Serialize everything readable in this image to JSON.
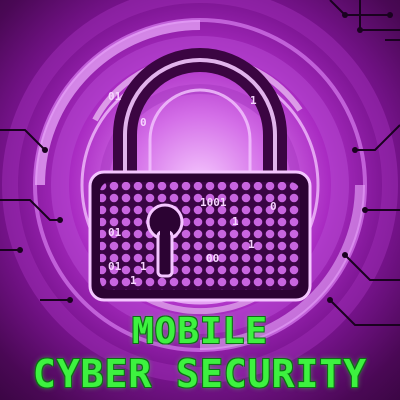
{
  "headline": {
    "line1": "MOBILE",
    "line2": "CYBER SECURITY"
  },
  "lock_digits": [
    "01",
    "1",
    "0",
    "1001",
    "1",
    "01",
    "1",
    "0",
    "00",
    "01",
    "1",
    "1"
  ],
  "colors": {
    "background": "#5a0c63",
    "glow": "#f6c9ff",
    "accent_purple": "#c04fd8",
    "headline_green": "#3df23f"
  },
  "icons": [
    "padlock-icon",
    "keyhole-icon",
    "circuit-traces"
  ]
}
